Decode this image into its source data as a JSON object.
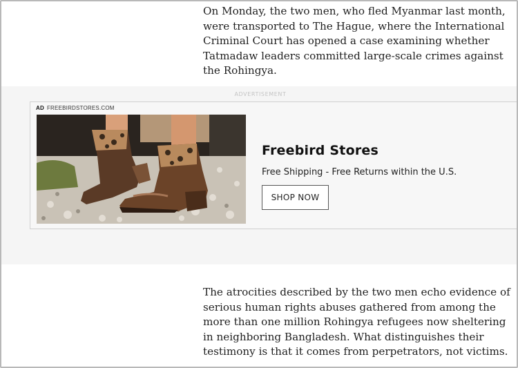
{
  "article": {
    "paragraph_top": "On Monday, the two men, who fled Myanmar last month, were transported to The Hague, where the International Criminal Court has opened a case examining whether Tatmadaw leaders committed large-scale crimes against the Rohingya.",
    "paragraph_bottom": "The atrocities described by the two men echo evidence of serious human rights abuses gathered from among the more than one million Rohingya refugees now sheltering in neighboring Bangladesh. What distinguishes their testimony is that it comes from perpetrators, not victims."
  },
  "ad": {
    "label": "ADVERTISEMENT",
    "badge": "AD",
    "source": "FREEBIRDSTORES.COM",
    "title": "Freebird Stores",
    "description": "Free Shipping - Free Returns within the U.S.",
    "cta": "SHOP NOW",
    "image_alt": "boots-photo"
  }
}
